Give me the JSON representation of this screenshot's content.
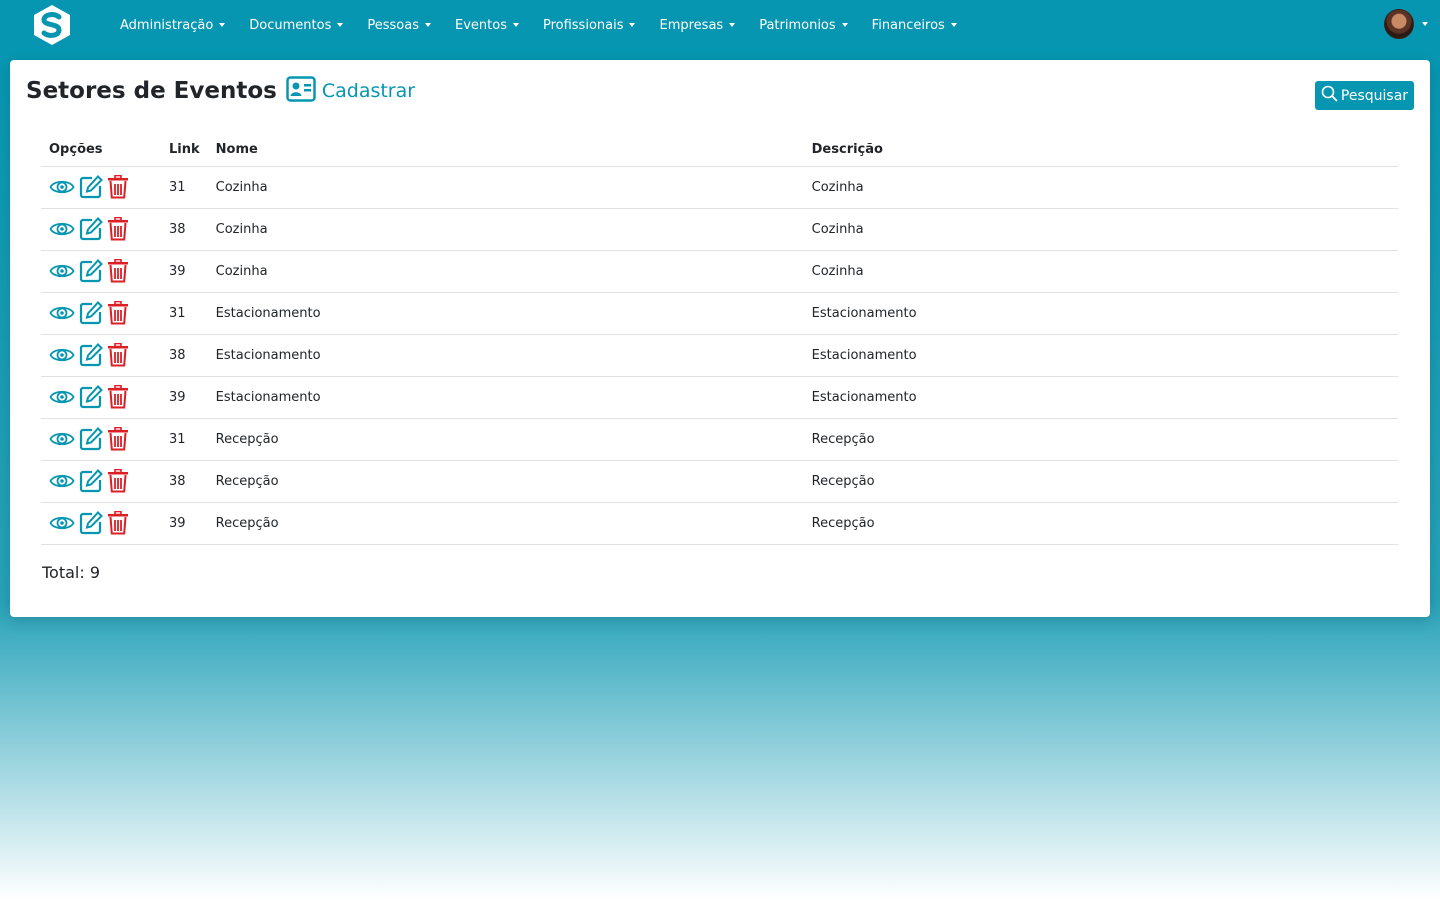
{
  "nav": {
    "items": [
      {
        "label": "Administração"
      },
      {
        "label": "Documentos"
      },
      {
        "label": "Pessoas"
      },
      {
        "label": "Eventos"
      },
      {
        "label": "Profissionais"
      },
      {
        "label": "Empresas"
      },
      {
        "label": "Patrimonios"
      },
      {
        "label": "Financeiros"
      }
    ]
  },
  "page": {
    "title": "Setores de Eventos",
    "create_label": "Cadastrar",
    "search_label": "Pesquisar",
    "total": "Total: 9"
  },
  "table": {
    "headers": {
      "options": "Opções",
      "link": "Link",
      "name": "Nome",
      "description": "Descrição"
    },
    "rows": [
      {
        "link": "31",
        "name": "Cozinha",
        "description": "Cozinha"
      },
      {
        "link": "38",
        "name": "Cozinha",
        "description": "Cozinha"
      },
      {
        "link": "39",
        "name": "Cozinha",
        "description": "Cozinha"
      },
      {
        "link": "31",
        "name": "Estacionamento",
        "description": "Estacionamento"
      },
      {
        "link": "38",
        "name": "Estacionamento",
        "description": "Estacionamento"
      },
      {
        "link": "39",
        "name": "Estacionamento",
        "description": "Estacionamento"
      },
      {
        "link": "31",
        "name": "Recepção",
        "description": "Recepção"
      },
      {
        "link": "38",
        "name": "Recepção",
        "description": "Recepção"
      },
      {
        "link": "39",
        "name": "Recepção",
        "description": "Recepção"
      }
    ]
  },
  "icons": {
    "brand": "logo-s-icon",
    "view": "eye-icon",
    "edit": "edit-icon",
    "delete": "trash-icon",
    "create": "id-card-icon",
    "search": "search-icon"
  },
  "colors": {
    "primary": "#0796b1",
    "danger": "#dc1f26"
  }
}
